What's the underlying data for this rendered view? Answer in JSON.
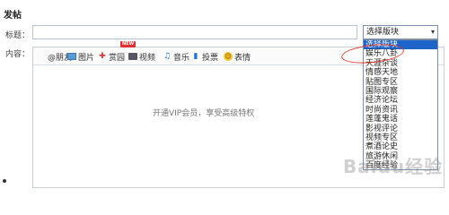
{
  "page": {
    "title": "发帖"
  },
  "form": {
    "title_label": "标题：",
    "content_label": "内容：",
    "title_value": ""
  },
  "toolbar": {
    "items": [
      {
        "label": "@朋友",
        "icon": "at-icon"
      },
      {
        "label": "图片",
        "icon": "image-icon"
      },
      {
        "label": "赏园",
        "icon": "gift-icon"
      },
      {
        "label": "视频",
        "icon": "video-icon"
      },
      {
        "label": "音乐",
        "icon": "music-icon"
      },
      {
        "label": "投票",
        "icon": "vote-icon"
      },
      {
        "label": "表情",
        "icon": "emoji-icon"
      }
    ],
    "new_badge": "NEW"
  },
  "editor": {
    "vip_hint": "开通VIP会员，享受高级特权"
  },
  "board_select": {
    "selected": "选择版块",
    "options": [
      "选择版块",
      "娱乐八卦",
      "天涯杂谈",
      "情感天地",
      "贴图专区",
      "国际观察",
      "经济论坛",
      "时尚资讯",
      "莲蓬鬼话",
      "影视评论",
      "视频专区",
      "煮酒论史",
      "旅游休闲",
      "百度经验"
    ],
    "highlighted_index": 0
  },
  "colors": {
    "highlight": "#1e64c8",
    "annotation": "#e03c31"
  },
  "watermark": "Baidu经验"
}
